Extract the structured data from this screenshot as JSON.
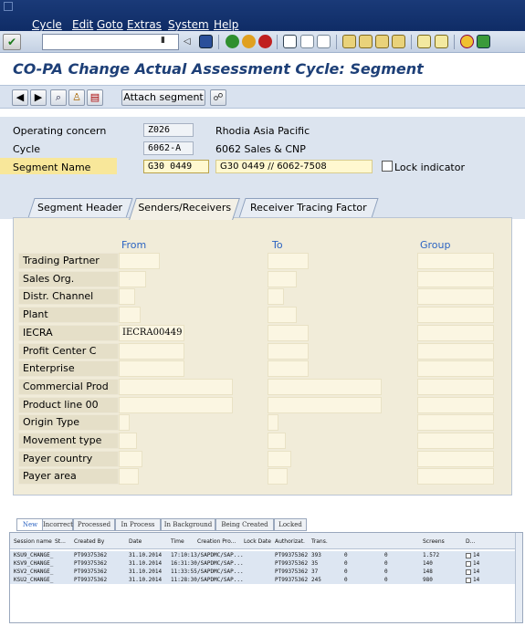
{
  "menu": [
    "Cycle",
    "Edit",
    "Goto",
    "Extras",
    "System",
    "Help"
  ],
  "title": "CO-PA Change Actual Assessment Cycle: Segment",
  "app_toolbar": {
    "attach_label": "Attach segment"
  },
  "header": {
    "operating_concern_label": "Operating concern",
    "operating_concern_value": "Z026",
    "operating_concern_text": "Rhodia Asia Pacific",
    "cycle_label": "Cycle",
    "cycle_value": "6062-A",
    "cycle_text": "6062 Sales & CNP",
    "segment_label": "Segment Name",
    "segment_value": "G30 0449",
    "segment_text": "G30 0449 // 6062-7508",
    "lock_label": "Lock indicator"
  },
  "tabs": [
    "Segment Header",
    "Senders/Receivers",
    "Receiver Tracing Factor"
  ],
  "columns": {
    "from": "From",
    "to": "To",
    "group": "Group"
  },
  "rows": [
    {
      "label": "Trading Partner",
      "from": ""
    },
    {
      "label": "Sales Org.",
      "from": ""
    },
    {
      "label": "Distr. Channel",
      "from": ""
    },
    {
      "label": "Plant",
      "from": ""
    },
    {
      "label": "IECRA",
      "from": "IECRA00449"
    },
    {
      "label": "Profit Center C",
      "from": ""
    },
    {
      "label": "Enterprise",
      "from": ""
    },
    {
      "label": "Commercial Prod",
      "from": ""
    },
    {
      "label": "Product line 00",
      "from": ""
    },
    {
      "label": "Origin Type",
      "from": ""
    },
    {
      "label": "Movement type",
      "from": ""
    },
    {
      "label": "Payer country",
      "from": ""
    },
    {
      "label": "Payer area",
      "from": ""
    }
  ],
  "bottom_tabs": [
    "New",
    "Incorrect",
    "Processed",
    "In Process",
    "In Background",
    "Being Created",
    "Locked"
  ],
  "grid": {
    "headers": [
      "Session name",
      "St...",
      "Created By",
      "Date",
      "Time",
      "Creation Pro...",
      "Lock Date",
      "Authorizat.",
      "Trans.",
      "",
      "",
      "Screens",
      "D..."
    ],
    "rows": [
      [
        "KSU9_CHANGE_",
        "",
        "PT99375362",
        "31.10.2014",
        "17:10:13",
        "/SAPDMC/SAP...",
        "",
        "PT99375362",
        "393",
        "0",
        "0",
        "1.572",
        "14"
      ],
      [
        "KSV9_CHANGE_",
        "",
        "PT99375362",
        "31.10.2014",
        "16:31:30",
        "/SAPDMC/SAP...",
        "",
        "PT99375362",
        "35",
        "0",
        "0",
        "140",
        "14"
      ],
      [
        "KSV2_CHANGE_",
        "",
        "PT99375362",
        "31.10.2014",
        "11:33:55",
        "/SAPDMC/SAP...",
        "",
        "PT99375362",
        "37",
        "0",
        "0",
        "148",
        "14"
      ],
      [
        "KSU2_CHANGE_",
        "",
        "PT99375362",
        "31.10.2014",
        "11:28:30",
        "/SAPDMC/SAP...",
        "",
        "PT99375362",
        "245",
        "0",
        "0",
        "980",
        "14"
      ]
    ]
  },
  "colors": {
    "menubar": "#0f2c66",
    "title": "#1d3f77",
    "accent": "#2b63c2",
    "panel": "#f1ecd9",
    "selection": "#f8e79a"
  }
}
